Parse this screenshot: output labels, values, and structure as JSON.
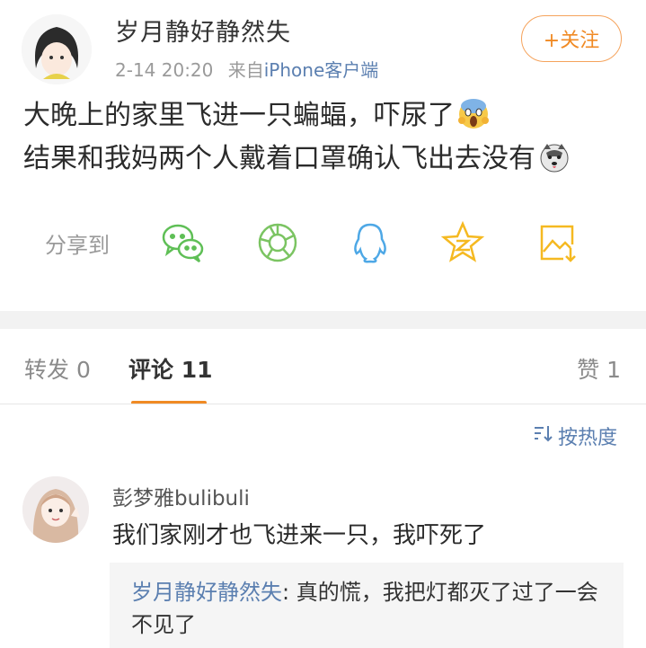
{
  "post": {
    "username": "岁月静好静然失",
    "date": "2-14 20:20",
    "source_prefix": "来自",
    "source": "iPhone客户端",
    "follow_label": "+关注",
    "line1": "大晚上的家里飞进一只蝙蝠，吓尿了",
    "line2": "结果和我妈两个人戴着口罩确认飞出去没有"
  },
  "share": {
    "label": "分享到",
    "icons": [
      "wechat-icon",
      "moments-icon",
      "qq-icon",
      "qzone-icon",
      "save-image-icon"
    ]
  },
  "tabs": {
    "repost": "转发 0",
    "comment": "评论 11",
    "like": "赞 1"
  },
  "sort_label": "按热度",
  "comment": {
    "username": "彭梦雅bulibuli",
    "text": "我们家刚才也飞进来一只，我吓死了",
    "reply_user": "岁月静好静然失",
    "reply_text": ": 真的慌，我把灯都灭了过了一会不见了"
  },
  "colors": {
    "accent": "#f08a24",
    "link": "#5b7fb0",
    "share_green": "#5fbf56",
    "share_blue": "#4ea8e6",
    "share_yellow": "#f5b921"
  }
}
